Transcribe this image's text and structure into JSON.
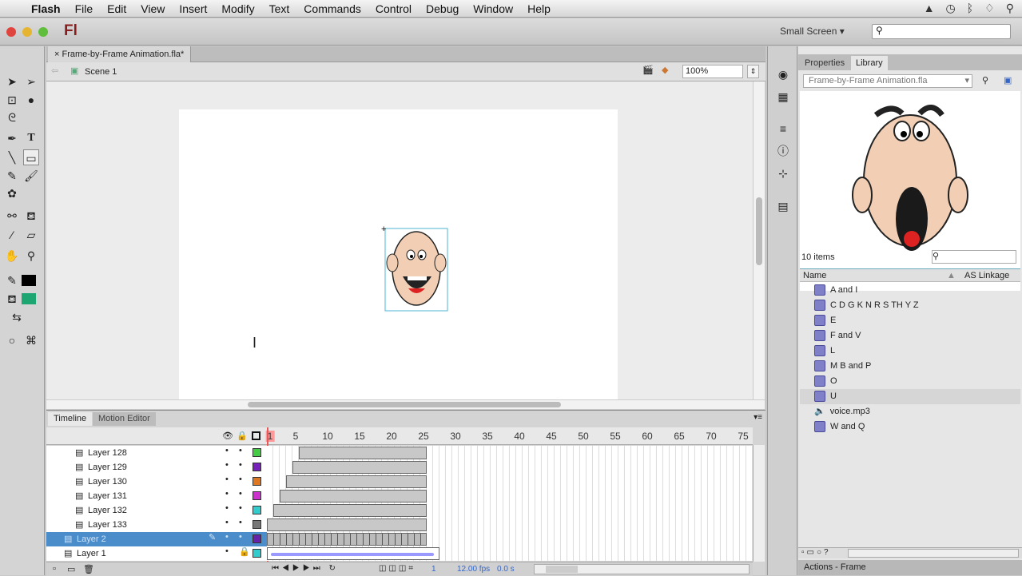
{
  "menubar": {
    "items": [
      "Flash",
      "File",
      "Edit",
      "View",
      "Insert",
      "Modify",
      "Text",
      "Commands",
      "Control",
      "Debug",
      "Window",
      "Help"
    ]
  },
  "app": {
    "logo": "Fl",
    "workspace": "Small Screen",
    "search_placeholder": ""
  },
  "document": {
    "tab": "Frame-by-Frame Animation.fla*",
    "scene": "Scene 1",
    "zoom": "100%"
  },
  "timeline": {
    "tabs": [
      "Timeline",
      "Motion Editor"
    ],
    "ruler": [
      "1",
      "5",
      "10",
      "15",
      "20",
      "25",
      "30",
      "35",
      "40",
      "45",
      "50",
      "55",
      "60",
      "65",
      "70",
      "75"
    ],
    "layers": [
      {
        "name": "Layer 128",
        "color": "#44cc44",
        "start": 6
      },
      {
        "name": "Layer 129",
        "color": "#7722bb",
        "start": 5
      },
      {
        "name": "Layer 130",
        "color": "#dd7722",
        "start": 4
      },
      {
        "name": "Layer 131",
        "color": "#cc33cc",
        "start": 3
      },
      {
        "name": "Layer 132",
        "color": "#33cccc",
        "start": 2
      },
      {
        "name": "Layer 133",
        "color": "#777777",
        "start": 1
      },
      {
        "name": "Layer 2",
        "color": "#6622aa",
        "start": 1,
        "selected": true
      },
      {
        "name": "Layer 1",
        "color": "#33cccc",
        "start": 1,
        "locked": true,
        "audio": true
      }
    ],
    "current_frame": "1",
    "fps": "12.00 fps",
    "time": "0.0 s"
  },
  "library": {
    "tabs": [
      "Properties",
      "Library"
    ],
    "document": "Frame-by-Frame Animation.fla",
    "count": "10 items",
    "col_name": "Name",
    "col_linkage": "AS Linkage",
    "items": [
      {
        "name": "A and I",
        "type": "symbol"
      },
      {
        "name": "C D G K N R S TH Y Z",
        "type": "symbol"
      },
      {
        "name": "E",
        "type": "symbol"
      },
      {
        "name": "F and V",
        "type": "symbol"
      },
      {
        "name": "L",
        "type": "symbol"
      },
      {
        "name": "M B and P",
        "type": "symbol"
      },
      {
        "name": "O",
        "type": "symbol"
      },
      {
        "name": "U",
        "type": "symbol",
        "highlighted": true
      },
      {
        "name": "voice.mp3",
        "type": "sound"
      },
      {
        "name": "W and Q",
        "type": "symbol"
      }
    ]
  },
  "actions_panel": "Actions - Frame"
}
